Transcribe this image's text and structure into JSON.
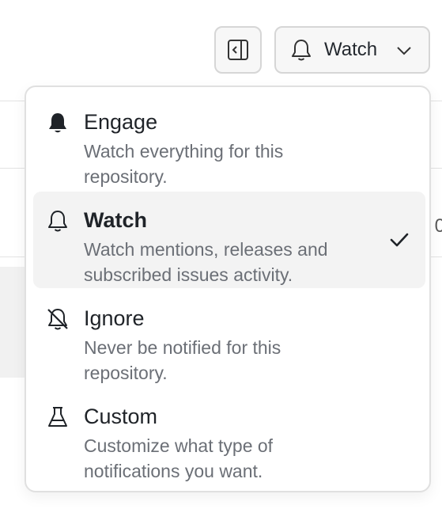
{
  "header": {
    "watch_button_label": "Watch",
    "icons": {
      "sidebar_toggle": "sidebar-collapse-icon",
      "watch": "bell-icon",
      "chevron": "chevron-down-icon"
    }
  },
  "background": {
    "right_edge_fragment": "0"
  },
  "menu": {
    "items": [
      {
        "id": "engage",
        "icon": "bell-filled-icon",
        "title": "Engage",
        "description": "Watch everything for this repository.",
        "selected": false
      },
      {
        "id": "watch",
        "icon": "bell-icon",
        "title": "Watch",
        "description": "Watch mentions, releases and subscribed issues activity.",
        "selected": true
      },
      {
        "id": "ignore",
        "icon": "bell-off-icon",
        "title": "Ignore",
        "description": "Never be notified for this repository.",
        "selected": false
      },
      {
        "id": "custom",
        "icon": "beaker-icon",
        "title": "Custom",
        "description": "Customize what type of notifications you want.",
        "selected": false
      }
    ]
  },
  "colors": {
    "selected_bg": "#f3f3f3",
    "text_primary": "#1f2328",
    "text_secondary": "#6b6f76",
    "border": "#d6d6d6"
  }
}
